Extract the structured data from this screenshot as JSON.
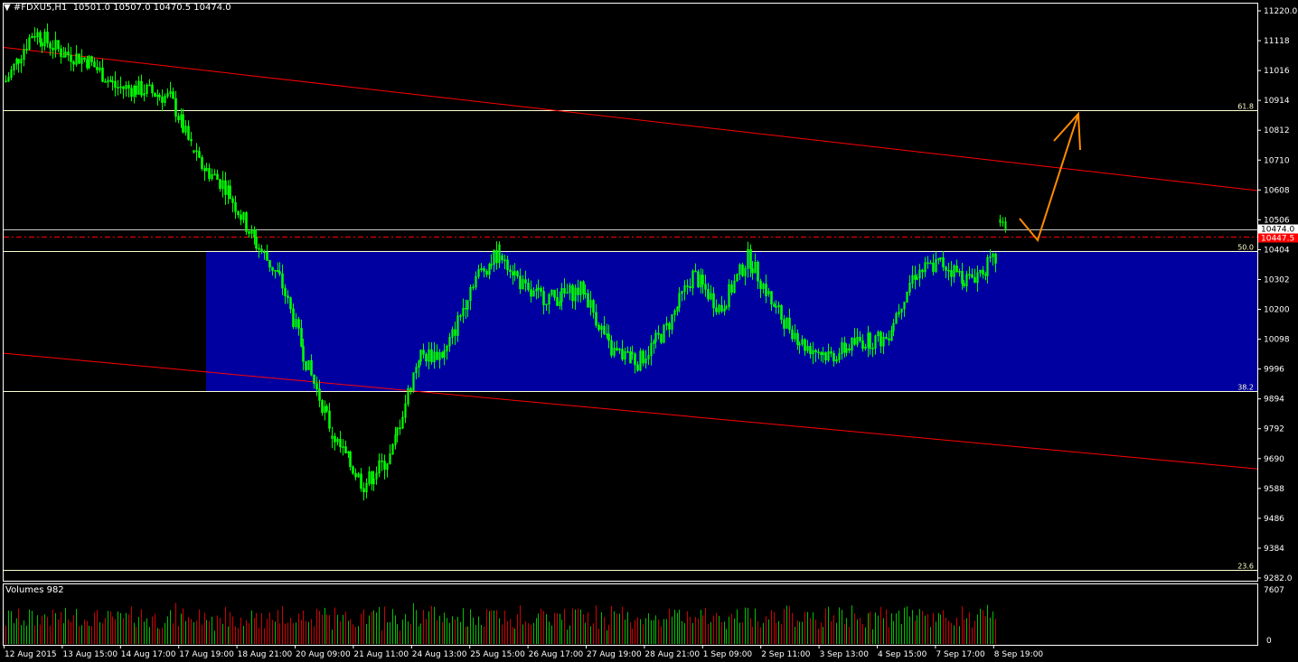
{
  "header": {
    "symbol": "#FDXU5,H1",
    "ohlc": "10501.0 10507.0 10470.5 10474.0"
  },
  "volume_panel": {
    "title": "Volumes 982",
    "max_label": "7607",
    "min_label": "0"
  },
  "colors": {
    "background": "#000000",
    "candle": "#00ff00",
    "zone": "#0000a0",
    "trend": "#ff0000",
    "fib": "#ffffd0",
    "arrow": "#ff8c00",
    "price_tag": "#ff0000"
  },
  "chart_data": {
    "type": "candlestick",
    "timeframe": "H1",
    "y_range": [
      9282,
      11220
    ],
    "price_ticks": [
      "11220.0",
      "11118",
      "11016",
      "10914",
      "10812",
      "10710",
      "10608",
      "10506",
      "10404",
      "10302",
      "10200",
      "10098",
      "9996",
      "9894",
      "9792",
      "9690",
      "9588",
      "9486",
      "9384",
      "9282.0"
    ],
    "time_labels": [
      "12 Aug 2015",
      "13 Aug 15:00",
      "14 Aug 17:00",
      "17 Aug 19:00",
      "18 Aug 21:00",
      "20 Aug 09:00",
      "21 Aug 11:00",
      "24 Aug 13:00",
      "25 Aug 15:00",
      "26 Aug 17:00",
      "27 Aug 19:00",
      "28 Aug 21:00",
      "1 Sep 09:00",
      "2 Sep 11:00",
      "3 Sep 13:00",
      "4 Sep 15:00",
      "7 Sep 17:00",
      "8 Sep 19:00"
    ],
    "fib_levels": [
      {
        "label": "61.8",
        "price": 10880
      },
      {
        "label": "50.0",
        "price": 10400
      },
      {
        "label": "38.2",
        "price": 9920
      },
      {
        "label": "23.6",
        "price": 9310
      }
    ],
    "current_price": {
      "label": "10474.0",
      "price": 10474
    },
    "sell_line": {
      "label": "10447.5",
      "price": 10447
    },
    "zone": {
      "price_top": 10400,
      "price_bottom": 9920
    },
    "trendlines": [
      {
        "price_start": 11095,
        "price_end": 10606
      },
      {
        "price_start": 10050,
        "price_end": 9655
      }
    ],
    "close_path": [
      10980,
      11150,
      11080,
      11050,
      10960,
      10950,
      10920,
      10700,
      10620,
      10440,
      10300,
      10000,
      9750,
      9600,
      9700,
      10040,
      10050,
      10300,
      10400,
      10250,
      10240,
      10270,
      10060,
      10020,
      10130,
      10320,
      10200,
      10380,
      10200,
      10080,
      10040,
      10090,
      10100,
      10320,
      10360,
      10300,
      10370
    ]
  }
}
